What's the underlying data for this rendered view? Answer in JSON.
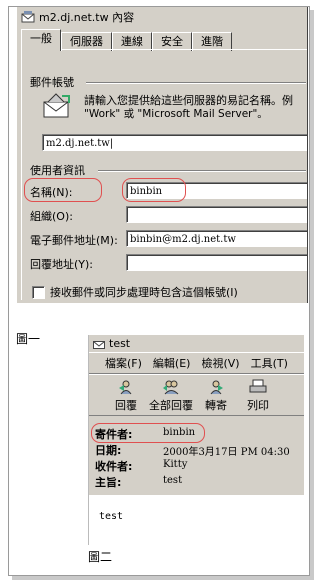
{
  "colors": {
    "dialog_bg": "#d4d0c8",
    "highlight_oval": "#e05050"
  },
  "fig1": {
    "title": "m2.dj.net.tw 內容",
    "tabs": [
      "一般",
      "伺服器",
      "連線",
      "安全",
      "進階"
    ],
    "account_group_label": "郵件帳號",
    "account_desc_line1": "請輸入您提供給這些伺服器的易記名稱。例",
    "account_desc_line2": "\"Work\" 或 \"Microsoft Mail Server\"。",
    "account_name_value": "m2.dj.net.tw|",
    "user_group_label": "使用者資訊",
    "name_label": "名稱(N):",
    "name_value": "binbin",
    "org_label": "組織(O):",
    "org_value": "",
    "email_label": "電子郵件地址(M):",
    "email_value": "binbin@m2.dj.net.tw",
    "reply_label": "回覆地址(Y):",
    "reply_value": "",
    "checkbox_label": "接收郵件或同步處理時包含這個帳號(I)"
  },
  "caption1": "圖一",
  "fig2": {
    "title": "test",
    "menus": [
      "檔案(F)",
      "編輯(E)",
      "檢視(V)",
      "工具(T)"
    ],
    "toolbar": [
      "回覆",
      "全部回覆",
      "轉寄",
      "列印"
    ],
    "from_label": "寄件者:",
    "from_value": "binbin",
    "date_label": "日期:",
    "date_value": "2000年3月17日 PM 04:30",
    "to_label": "收件者:",
    "to_value": "Kitty",
    "subject_label": "主旨:",
    "subject_value": "test",
    "body_text": "test"
  },
  "caption2": "圖二"
}
